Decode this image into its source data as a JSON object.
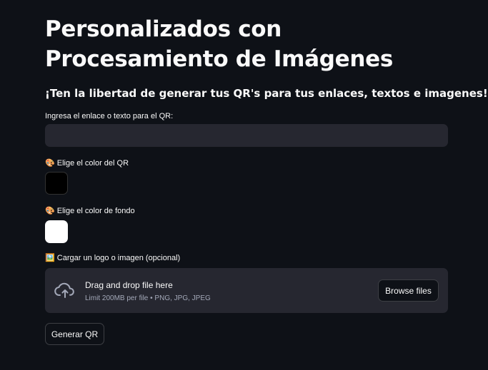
{
  "header": {
    "title": "Personalizados con Procesamiento de Imágenes",
    "subtitle": "¡Ten la libertad de generar tus QR's para tus enlaces, textos e imagenes!",
    "subtitle_emoji": "🚀"
  },
  "form": {
    "text_input": {
      "label": "Ingresa el enlace o texto para el QR:",
      "value": "",
      "placeholder": ""
    },
    "qr_color": {
      "emoji": "🎨",
      "label": "Elige el color del QR",
      "value": "#000000"
    },
    "bg_color": {
      "emoji": "🎨",
      "label": "Elige el color de fondo",
      "value": "#ffffff"
    },
    "uploader": {
      "emoji": "🖼️",
      "label": "Cargar un logo o imagen (opcional)",
      "drop_text": "Drag and drop file here",
      "limit_text": "Limit 200MB per file • PNG, JPG, JPEG",
      "browse_label": "Browse files",
      "icon": "cloud-upload-icon"
    },
    "generate_label": "Generar QR"
  },
  "colors": {
    "background": "#0e1117",
    "input_bg": "#262730",
    "text": "#fafafa",
    "muted_text": "#a3a8b8"
  }
}
